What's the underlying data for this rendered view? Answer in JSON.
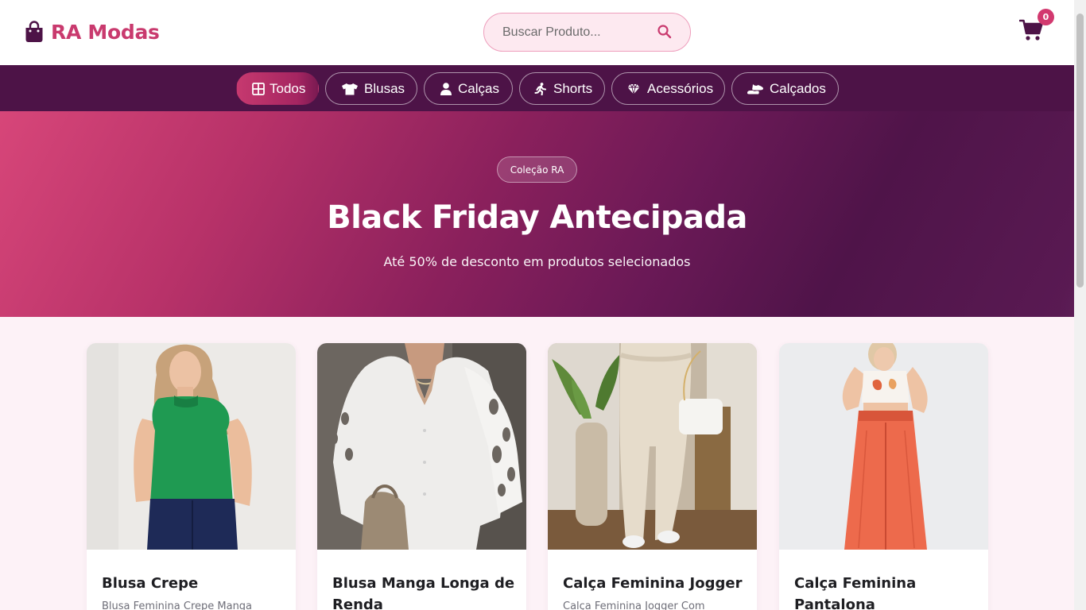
{
  "header": {
    "brand": "RA Modas",
    "search_placeholder": "Buscar Produto...",
    "cart_count": "0"
  },
  "categories": [
    {
      "label": "Todos",
      "icon": "grid-icon",
      "active": true
    },
    {
      "label": "Blusas",
      "icon": "shirt-icon",
      "active": false
    },
    {
      "label": "Calças",
      "icon": "user-icon",
      "active": false
    },
    {
      "label": "Shorts",
      "icon": "running-person-icon",
      "active": false
    },
    {
      "label": "Acessórios",
      "icon": "gem-icon",
      "active": false
    },
    {
      "label": "Calçados",
      "icon": "shoe-icon",
      "active": false
    }
  ],
  "hero": {
    "tag": "Coleção RA",
    "title": "Black Friday Antecipada",
    "subtitle": "Até 50% de desconto em produtos selecionados"
  },
  "products": [
    {
      "title": "Blusa Crepe",
      "description": "Blusa Feminina Crepe Manga",
      "image": "green-sleeveless-blouse-photo"
    },
    {
      "title": "Blusa Manga Longa de Renda",
      "description": "",
      "image": "white-lace-sleeve-blouse-photo"
    },
    {
      "title": "Calça Feminina Jogger",
      "description": "Calça Feminina Jogger Com",
      "image": "beige-jogger-pants-photo"
    },
    {
      "title": "Calça Feminina Pantalona",
      "description": "",
      "image": "coral-wide-leg-pants-photo"
    }
  ],
  "colors": {
    "brand": "#c93a6e",
    "nav_bg": "#4d1347",
    "accent": "#d2396f",
    "page_bg": "#fdf2f7"
  }
}
